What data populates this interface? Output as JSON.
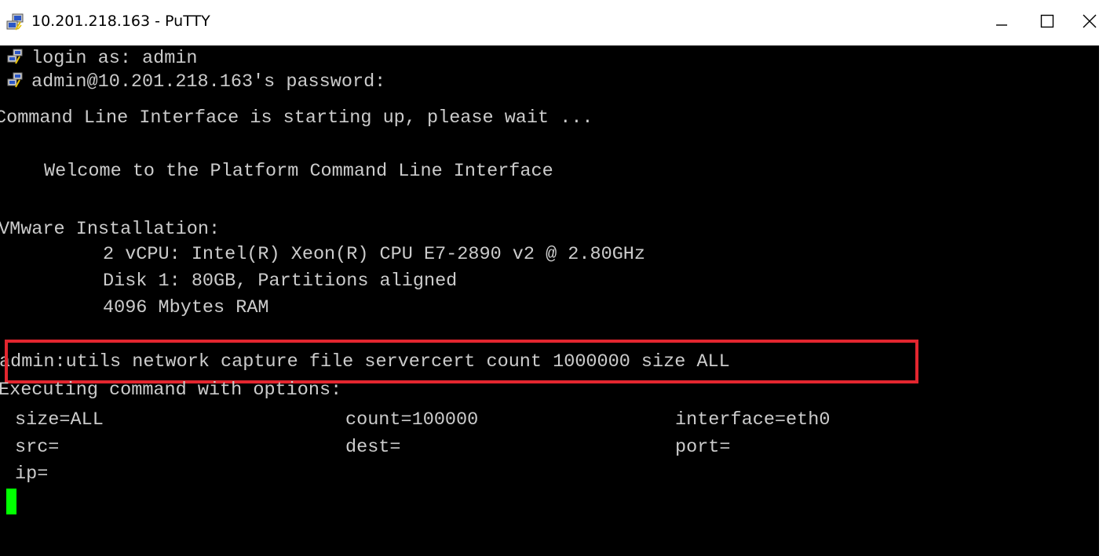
{
  "window": {
    "title": "10.201.218.163 - PuTTY",
    "icon": "putty-computer-icon",
    "controls": {
      "minimize_glyph": "minimize-icon",
      "maximize_glyph": "maximize-icon",
      "close_glyph": "close-icon"
    }
  },
  "terminal": {
    "background": "#000000",
    "text_color": "#cccccc",
    "cursor_color": "#00ff00",
    "highlight_color": "#e3262f",
    "lines": {
      "login": "login as: admin",
      "password": "admin@10.201.218.163's password:",
      "starting": "Command Line Interface is starting up, please wait ...",
      "welcome": "Welcome to the Platform Command Line Interface",
      "vmware": "VMware Installation:",
      "cpu": "2 vCPU: Intel(R) Xeon(R) CPU E7-2890 v2 @ 2.80GHz",
      "disk": "Disk 1: 80GB, Partitions aligned",
      "ram": "4096 Mbytes RAM",
      "command": "admin:utils network capture file servercert count 1000000 size ALL",
      "executing": "Executing command with options:"
    },
    "options": {
      "size": "size=ALL",
      "count": "count=100000",
      "interface": "interface=eth0",
      "src": "src=",
      "dest": "dest=",
      "port": "port=",
      "ip": "ip="
    }
  }
}
